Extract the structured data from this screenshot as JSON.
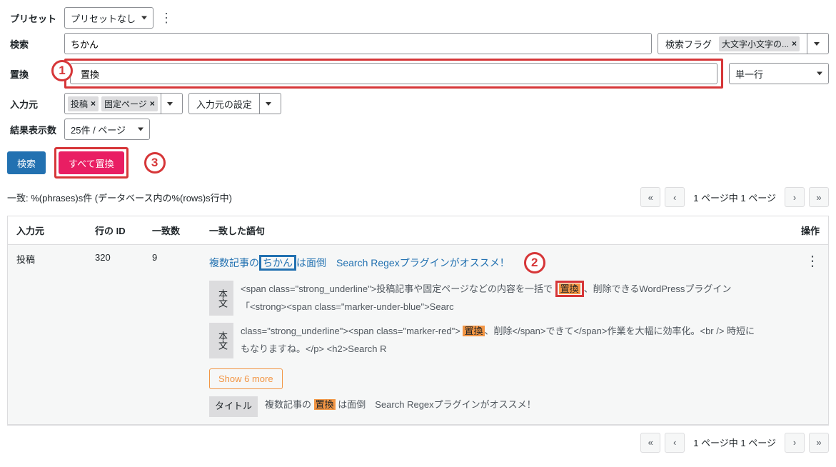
{
  "form": {
    "preset_label": "プリセット",
    "preset_value": "プリセットなし",
    "search_label": "検索",
    "search_value": "ちかん",
    "search_flags_label": "検索フラグ",
    "search_flags_pill": "大文字小文字の...",
    "replace_label": "置換",
    "replace_value": "置換",
    "replace_mode": "単一行",
    "source_label": "入力元",
    "source_pill_post": "投稿",
    "source_pill_page": "固定ページ",
    "source_settings": "入力元の設定",
    "perpage_label": "結果表示数",
    "perpage_value": "25件 / ページ",
    "btn_search": "検索",
    "btn_replace_all": "すべて置換"
  },
  "callouts": {
    "one": "1",
    "two": "2",
    "three": "3"
  },
  "matches_text": "一致: %(phrases)s件 (データベース内の%(rows)s行中)",
  "pager": {
    "first": "«",
    "prev": "‹",
    "text": "1 ページ中 1 ページ",
    "next": "›",
    "last": "»"
  },
  "results_header": {
    "source": "入力元",
    "id": "行の ID",
    "matches": "一致数",
    "phrase": "一致した語句",
    "ops": "操作"
  },
  "row": {
    "source": "投稿",
    "id": "320",
    "matches": "9",
    "title_pre": "複数記事の",
    "title_hl": "ちかん",
    "title_post": "は面倒　Search Regexプラグインがオススメ！",
    "body_tag": "本文",
    "body1_pre": "<span class=\"strong_underline\">投稿記事や固定ページなどの内容を一括で ",
    "body1_hl": "置換",
    "body1_post": "、削除できるWordPressプラグイン「<strong><span class=\"marker-under-blue\">Searc",
    "body2_pre": "class=\"strong_underline\"><span class=\"marker-red\"> ",
    "body2_hl": "置換",
    "body2_post": "、削除</span>できて</span>作業を大幅に効率化。<br /> 時短にもなりますね。</p> <h2>Search R",
    "show_more": "Show 6 more",
    "title_tag": "タイトル",
    "titleline_pre": "複数記事の ",
    "titleline_hl": "置換",
    "titleline_post": " は面倒　Search Regexプラグインがオススメ！"
  }
}
